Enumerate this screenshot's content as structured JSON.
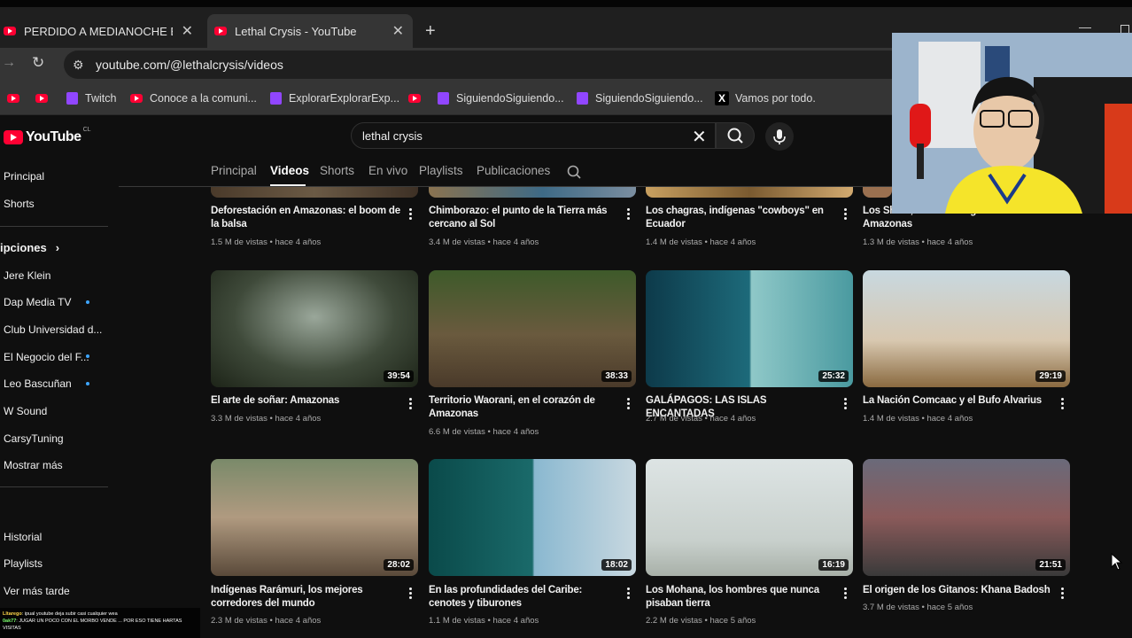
{
  "browser": {
    "tabs": [
      {
        "title": "PERDIDO A MEDIANOCHE EN L",
        "active": false
      },
      {
        "title": "Lethal Crysis - YouTube",
        "active": true
      }
    ],
    "url": "youtube.com/@lethalcrysis/videos",
    "bookmarks": [
      {
        "icon": "youtube-icon",
        "label": ""
      },
      {
        "icon": "youtube-icon",
        "label": ""
      },
      {
        "icon": "twitch-icon",
        "label": "Twitch"
      },
      {
        "icon": "youtube-icon",
        "label": "Conoce a la comuni..."
      },
      {
        "icon": "twitch-icon",
        "label": "ExplorarExplorarExp..."
      },
      {
        "icon": "youtube-icon",
        "label": ""
      },
      {
        "icon": "twitch-icon",
        "label": "SiguiendoSiguiendo..."
      },
      {
        "icon": "twitch-icon",
        "label": "SiguiendoSiguiendo..."
      },
      {
        "icon": "x-icon",
        "label": "Vamos por todo."
      }
    ]
  },
  "youtube": {
    "logo_text": "YouTube",
    "country_code": "CL",
    "search_query": "lethal crysis",
    "channel_tabs": [
      "Principal",
      "Videos",
      "Shorts",
      "En vivo",
      "Playlists",
      "Publicaciones"
    ],
    "active_tab": "Videos"
  },
  "sidebar": {
    "top": [
      "Principal",
      "Shorts"
    ],
    "subs_heading": "ipciones",
    "subscriptions": [
      {
        "name": "Jere Klein",
        "live": false
      },
      {
        "name": "Dap Media TV",
        "live": true
      },
      {
        "name": "Club Universidad d...",
        "live": false
      },
      {
        "name": "El Negocio del F...",
        "live": true
      },
      {
        "name": "Leo Bascuñan",
        "live": true
      },
      {
        "name": "W Sound",
        "live": false
      },
      {
        "name": "CarsyTuning",
        "live": false
      },
      {
        "name": "Mostrar más",
        "live": false
      }
    ],
    "you": [
      "Historial",
      "Playlists",
      "Ver más tarde"
    ]
  },
  "videos": [
    {
      "title": "Deforestación en Amazonas: el boom de la balsa",
      "meta": "1.5 M de vistas • hace 4 años",
      "duration": ""
    },
    {
      "title": "Chimborazo: el punto de la Tierra más cercano al Sol",
      "meta": "3.4 M de vistas • hace 4 años",
      "duration": ""
    },
    {
      "title": "Los chagras, indígenas \"cowboys\" en Ecuador",
      "meta": "1.4 M de vistas • hace 4 años",
      "duration": ""
    },
    {
      "title": "Los Shuar, los últimos guerreros de Amazonas",
      "meta": "1.3 M de vistas • hace 4 años",
      "duration": ""
    },
    {
      "title": "El arte de soñar: Amazonas",
      "meta": "3.3 M de vistas • hace 4 años",
      "duration": "39:54"
    },
    {
      "title": "Territorio Waorani, en el corazón de Amazonas",
      "meta": "6.6 M de vistas • hace 4 años",
      "duration": "38:33"
    },
    {
      "title": "GALÁPAGOS: LAS ISLAS ENCANTADAS",
      "meta": "2.7 M de vistas • hace 4 años",
      "duration": "25:32"
    },
    {
      "title": "La Nación Comcaac y el Bufo Alvarius",
      "meta": "1.4 M de vistas • hace 4 años",
      "duration": "29:19"
    },
    {
      "title": "Indígenas Rarámuri, los mejores corredores del mundo",
      "meta": "2.3 M de vistas • hace 4 años",
      "duration": "28:02"
    },
    {
      "title": "En las profundidades del Caribe: cenotes y tiburones",
      "meta": "1.1 M de vistas • hace 4 años",
      "duration": "18:02"
    },
    {
      "title": "Los Mohana, los hombres que nunca pisaban tierra",
      "meta": "2.2 M de vistas • hace 5 años",
      "duration": "16:19"
    },
    {
      "title": "El origen de los Gitanos: Khana Badosh",
      "meta": "3.7 M de vistas • hace 5 años",
      "duration": "21:51"
    }
  ],
  "chat": {
    "line1_user": "Lltarego",
    "line1_text": ": ipual youtube deja subir casi cualquier wea",
    "line2_user": "0ak77",
    "line2_text": ": JUGAR UN POCO CON EL MORBO VENDE ... POR ESO TIENE HARTAS VISITAS"
  },
  "colors": {
    "youtube_red": "#ff0033",
    "twitch_purple": "#9146ff",
    "live_dot": "#3ea6ff"
  }
}
